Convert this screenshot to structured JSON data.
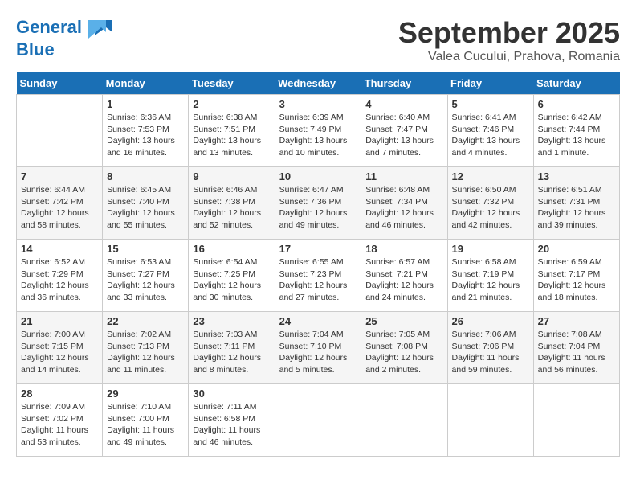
{
  "header": {
    "logo_line1": "General",
    "logo_line2": "Blue",
    "month": "September 2025",
    "location": "Valea Cucului, Prahova, Romania"
  },
  "weekdays": [
    "Sunday",
    "Monday",
    "Tuesday",
    "Wednesday",
    "Thursday",
    "Friday",
    "Saturday"
  ],
  "weeks": [
    [
      {
        "day": "",
        "info": ""
      },
      {
        "day": "1",
        "info": "Sunrise: 6:36 AM\nSunset: 7:53 PM\nDaylight: 13 hours\nand 16 minutes."
      },
      {
        "day": "2",
        "info": "Sunrise: 6:38 AM\nSunset: 7:51 PM\nDaylight: 13 hours\nand 13 minutes."
      },
      {
        "day": "3",
        "info": "Sunrise: 6:39 AM\nSunset: 7:49 PM\nDaylight: 13 hours\nand 10 minutes."
      },
      {
        "day": "4",
        "info": "Sunrise: 6:40 AM\nSunset: 7:47 PM\nDaylight: 13 hours\nand 7 minutes."
      },
      {
        "day": "5",
        "info": "Sunrise: 6:41 AM\nSunset: 7:46 PM\nDaylight: 13 hours\nand 4 minutes."
      },
      {
        "day": "6",
        "info": "Sunrise: 6:42 AM\nSunset: 7:44 PM\nDaylight: 13 hours\nand 1 minute."
      }
    ],
    [
      {
        "day": "7",
        "info": "Sunrise: 6:44 AM\nSunset: 7:42 PM\nDaylight: 12 hours\nand 58 minutes."
      },
      {
        "day": "8",
        "info": "Sunrise: 6:45 AM\nSunset: 7:40 PM\nDaylight: 12 hours\nand 55 minutes."
      },
      {
        "day": "9",
        "info": "Sunrise: 6:46 AM\nSunset: 7:38 PM\nDaylight: 12 hours\nand 52 minutes."
      },
      {
        "day": "10",
        "info": "Sunrise: 6:47 AM\nSunset: 7:36 PM\nDaylight: 12 hours\nand 49 minutes."
      },
      {
        "day": "11",
        "info": "Sunrise: 6:48 AM\nSunset: 7:34 PM\nDaylight: 12 hours\nand 46 minutes."
      },
      {
        "day": "12",
        "info": "Sunrise: 6:50 AM\nSunset: 7:32 PM\nDaylight: 12 hours\nand 42 minutes."
      },
      {
        "day": "13",
        "info": "Sunrise: 6:51 AM\nSunset: 7:31 PM\nDaylight: 12 hours\nand 39 minutes."
      }
    ],
    [
      {
        "day": "14",
        "info": "Sunrise: 6:52 AM\nSunset: 7:29 PM\nDaylight: 12 hours\nand 36 minutes."
      },
      {
        "day": "15",
        "info": "Sunrise: 6:53 AM\nSunset: 7:27 PM\nDaylight: 12 hours\nand 33 minutes."
      },
      {
        "day": "16",
        "info": "Sunrise: 6:54 AM\nSunset: 7:25 PM\nDaylight: 12 hours\nand 30 minutes."
      },
      {
        "day": "17",
        "info": "Sunrise: 6:55 AM\nSunset: 7:23 PM\nDaylight: 12 hours\nand 27 minutes."
      },
      {
        "day": "18",
        "info": "Sunrise: 6:57 AM\nSunset: 7:21 PM\nDaylight: 12 hours\nand 24 minutes."
      },
      {
        "day": "19",
        "info": "Sunrise: 6:58 AM\nSunset: 7:19 PM\nDaylight: 12 hours\nand 21 minutes."
      },
      {
        "day": "20",
        "info": "Sunrise: 6:59 AM\nSunset: 7:17 PM\nDaylight: 12 hours\nand 18 minutes."
      }
    ],
    [
      {
        "day": "21",
        "info": "Sunrise: 7:00 AM\nSunset: 7:15 PM\nDaylight: 12 hours\nand 14 minutes."
      },
      {
        "day": "22",
        "info": "Sunrise: 7:02 AM\nSunset: 7:13 PM\nDaylight: 12 hours\nand 11 minutes."
      },
      {
        "day": "23",
        "info": "Sunrise: 7:03 AM\nSunset: 7:11 PM\nDaylight: 12 hours\nand 8 minutes."
      },
      {
        "day": "24",
        "info": "Sunrise: 7:04 AM\nSunset: 7:10 PM\nDaylight: 12 hours\nand 5 minutes."
      },
      {
        "day": "25",
        "info": "Sunrise: 7:05 AM\nSunset: 7:08 PM\nDaylight: 12 hours\nand 2 minutes."
      },
      {
        "day": "26",
        "info": "Sunrise: 7:06 AM\nSunset: 7:06 PM\nDaylight: 11 hours\nand 59 minutes."
      },
      {
        "day": "27",
        "info": "Sunrise: 7:08 AM\nSunset: 7:04 PM\nDaylight: 11 hours\nand 56 minutes."
      }
    ],
    [
      {
        "day": "28",
        "info": "Sunrise: 7:09 AM\nSunset: 7:02 PM\nDaylight: 11 hours\nand 53 minutes."
      },
      {
        "day": "29",
        "info": "Sunrise: 7:10 AM\nSunset: 7:00 PM\nDaylight: 11 hours\nand 49 minutes."
      },
      {
        "day": "30",
        "info": "Sunrise: 7:11 AM\nSunset: 6:58 PM\nDaylight: 11 hours\nand 46 minutes."
      },
      {
        "day": "",
        "info": ""
      },
      {
        "day": "",
        "info": ""
      },
      {
        "day": "",
        "info": ""
      },
      {
        "day": "",
        "info": ""
      }
    ]
  ]
}
